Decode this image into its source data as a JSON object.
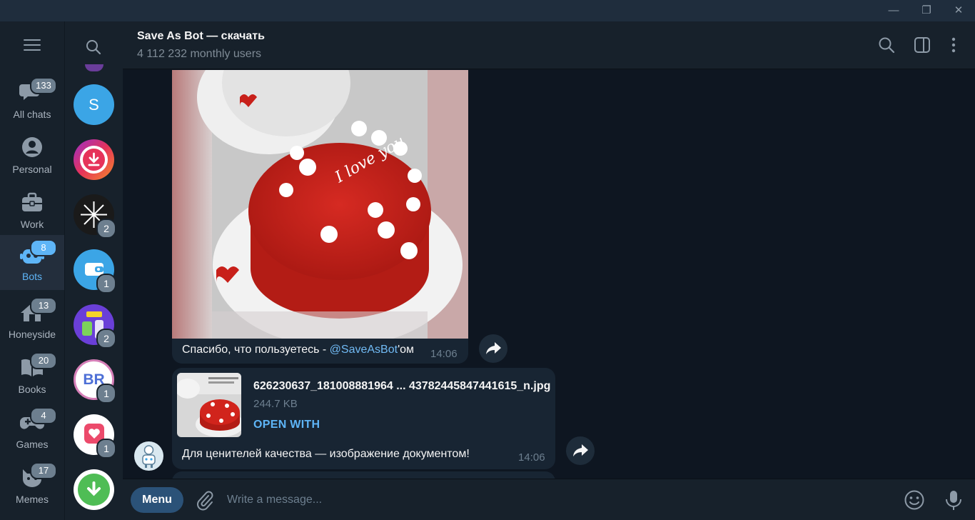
{
  "window": {
    "minimize_glyph": "—",
    "restore_glyph": "❐",
    "close_glyph": "✕"
  },
  "folders": [
    {
      "label": "All chats",
      "badge": "133",
      "icon": "chats-icon"
    },
    {
      "label": "Personal",
      "badge": "",
      "icon": "person-icon"
    },
    {
      "label": "Work",
      "badge": "",
      "icon": "briefcase-icon"
    },
    {
      "label": "Bots",
      "badge": "8",
      "icon": "bot-icon",
      "active": true
    },
    {
      "label": "Honeyside",
      "badge": "13",
      "icon": "house-icon"
    },
    {
      "label": "Books",
      "badge": "20",
      "icon": "book-icon"
    },
    {
      "label": "Games",
      "badge": "4",
      "icon": "gamepad-icon"
    },
    {
      "label": "Memes",
      "badge": "17",
      "icon": "cat-icon"
    }
  ],
  "chat_list": [
    {
      "initial": "S",
      "badge": ""
    },
    {
      "initial": "",
      "badge": ""
    },
    {
      "initial": "",
      "badge": "2"
    },
    {
      "initial": "",
      "badge": "1"
    },
    {
      "initial": "",
      "badge": "2"
    },
    {
      "initial": "BR",
      "badge": "1"
    },
    {
      "initial": "",
      "badge": "1"
    },
    {
      "initial": "",
      "badge": ""
    }
  ],
  "header": {
    "title": "Save As Bot — скачать",
    "subtitle": "4 112 232 monthly users"
  },
  "messages": {
    "photo": {
      "caption_prefix": "Спасибо, что пользуетесь - ",
      "caption_link": "@SaveAsBot",
      "caption_suffix": "'ом",
      "time": "14:06",
      "image_text": "I love you"
    },
    "document": {
      "filename": "626230637_181008881964 ... 43782445847441615_n.jpg",
      "size": "244.7 KB",
      "open_label": "OPEN WITH",
      "caption": "Для ценителей качества — изображение документом!",
      "time": "14:06"
    }
  },
  "composer": {
    "menu_label": "Menu",
    "placeholder": "Write a message..."
  },
  "colors": {
    "accent": "#5eb5f7",
    "link": "#71baf4",
    "background": "#0e1621",
    "panel": "#17212b",
    "bubble": "#182533",
    "menu_button": "#2b5278"
  }
}
